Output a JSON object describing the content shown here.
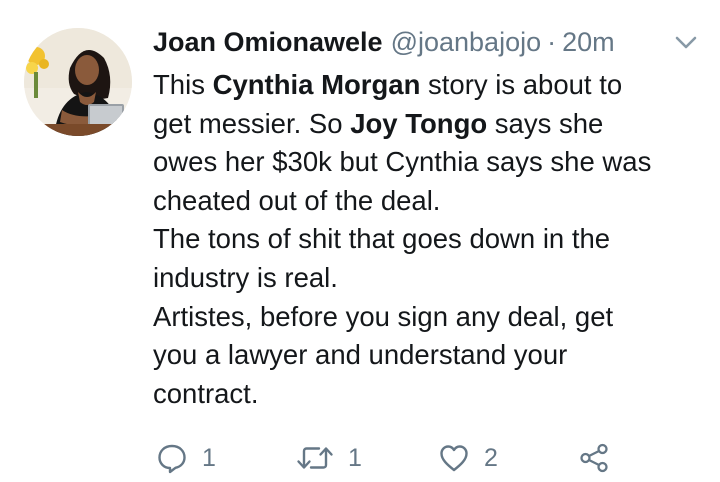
{
  "tweet": {
    "display_name": "Joan Omionawele",
    "handle": "@joanbajojo",
    "separator": "·",
    "time": "20m",
    "text_lines": [
      [
        "This ",
        "Cynthia Morgan",
        " story is about to"
      ],
      [
        "get messier. So ",
        "Joy Tongo",
        " says she"
      ],
      [
        "owes her $30k but Cynthia says she was"
      ],
      [
        "cheated out of the deal."
      ],
      [
        "The tons of shit that goes down in the"
      ],
      [
        "industry is real."
      ],
      [
        "Artistes, before you sign any deal, get"
      ],
      [
        "you a lawyer and understand your"
      ],
      [
        "contract."
      ]
    ],
    "actions": {
      "reply_count": "1",
      "retweet_count": "1",
      "like_count": "2"
    }
  },
  "icons": {
    "reply": "reply-icon",
    "retweet": "retweet-icon",
    "like": "heart-icon",
    "share": "share-icon",
    "menu": "chevron-down-icon"
  },
  "colors": {
    "text": "#14171a",
    "secondary": "#657786"
  }
}
